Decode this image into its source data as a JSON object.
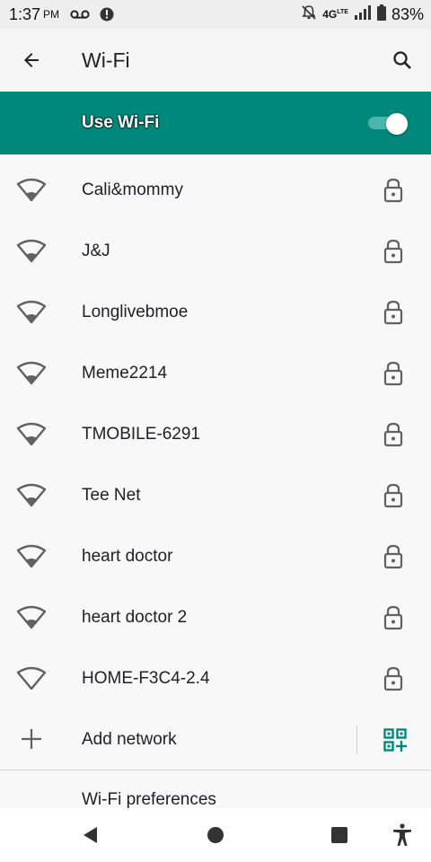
{
  "status_bar": {
    "time": "1:37",
    "ampm": "PM",
    "network": "4G",
    "network_sup": "LTE",
    "battery": "83%"
  },
  "app_bar": {
    "title": "Wi-Fi",
    "back_icon": "arrow-back-icon",
    "search_icon": "search-icon"
  },
  "master_switch": {
    "label": "Use Wi-Fi",
    "on": true,
    "color": "#00897b"
  },
  "networks": [
    {
      "name": "Cali&mommy",
      "secured": true
    },
    {
      "name": "J&J",
      "secured": true
    },
    {
      "name": "Longlivebmoe",
      "secured": true
    },
    {
      "name": "Meme2214",
      "secured": true
    },
    {
      "name": "TMOBILE-6291",
      "secured": true
    },
    {
      "name": "Tee Net",
      "secured": true
    },
    {
      "name": "heart doctor",
      "secured": true
    },
    {
      "name": "heart doctor 2",
      "secured": true
    },
    {
      "name": "HOME-F3C4-2.4",
      "secured": true
    }
  ],
  "add_network": {
    "label": "Add network",
    "qr_icon": "qr-scan-icon"
  },
  "preferences": {
    "label": "Wi-Fi preferences"
  },
  "nav_bar": {
    "icons": [
      "back-triangle-icon",
      "home-circle-icon",
      "recents-square-icon",
      "accessibility-icon"
    ]
  }
}
